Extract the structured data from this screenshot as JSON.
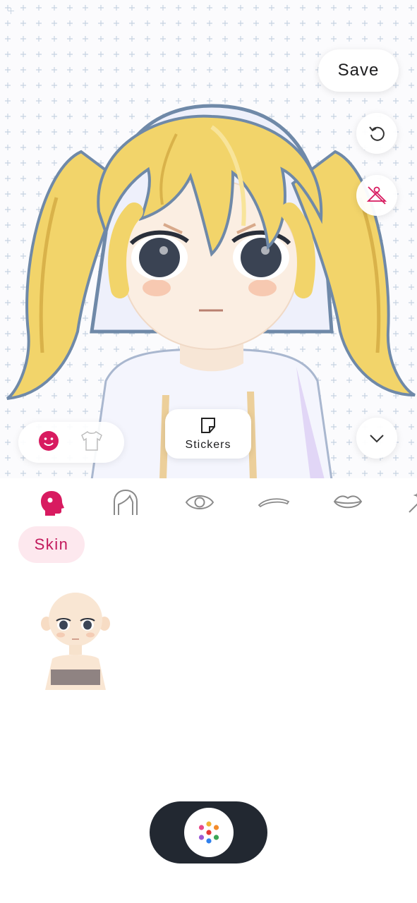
{
  "toolbar": {
    "save_label": "Save",
    "undo_icon": "undo-icon",
    "hide_clothes_icon": "hanger-off-icon",
    "collapse_icon": "chevron-down-icon"
  },
  "mode_switch": {
    "items": [
      {
        "icon": "face-icon",
        "selected": true
      },
      {
        "icon": "shirt-icon",
        "selected": false
      }
    ]
  },
  "stickers": {
    "label": "Stickers",
    "icon": "sticker-icon"
  },
  "categories": [
    {
      "icon": "head-icon",
      "selected": true
    },
    {
      "icon": "hair-icon",
      "selected": false
    },
    {
      "icon": "eye-icon",
      "selected": false
    },
    {
      "icon": "eyebrow-icon",
      "selected": false
    },
    {
      "icon": "lips-icon",
      "selected": false
    },
    {
      "icon": "magic-wand-icon",
      "selected": false
    }
  ],
  "subtabs": [
    {
      "label": "Skin",
      "selected": true
    }
  ],
  "items": [
    {
      "icon": "skin-preset-thumbnail"
    }
  ],
  "dock": {
    "icon": "launcher-dots-icon"
  },
  "colors": {
    "accent": "#d81b60",
    "accent_bg": "#fde8ee",
    "dock": "#222831",
    "hair": "#f2d46a",
    "grid": "#c9d5e3"
  }
}
